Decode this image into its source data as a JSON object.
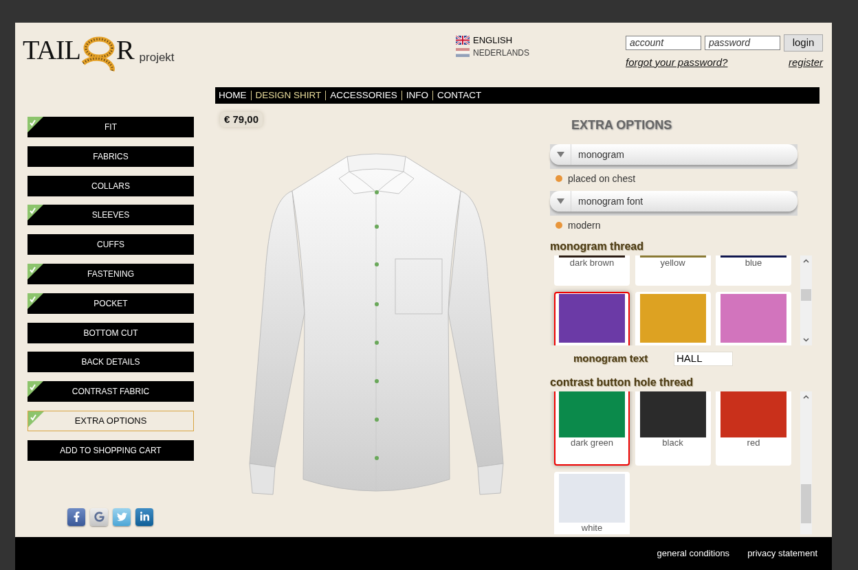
{
  "logo": {
    "text_left": "TAIL",
    "text_right": "R",
    "subtitle": "projekt"
  },
  "languages": [
    {
      "kind": "uk",
      "label": "ENGLISH",
      "selected": true
    },
    {
      "kind": "nl",
      "label": "NEDERLANDS",
      "selected": false
    }
  ],
  "login": {
    "account": {
      "placeholder": "account"
    },
    "password": {
      "placeholder": "password"
    },
    "button": "login",
    "forgot_link": "forgot your password?",
    "register_link": "register"
  },
  "nav": [
    {
      "label": "HOME",
      "selected": false
    },
    {
      "label": "DESIGN SHIRT",
      "selected": true
    },
    {
      "label": "ACCESSORIES",
      "selected": false
    },
    {
      "label": "INFO",
      "selected": false
    },
    {
      "label": "CONTACT",
      "selected": false
    }
  ],
  "sidebar": {
    "items": [
      {
        "label": "FIT",
        "checked": true,
        "selected": false
      },
      {
        "label": "FABRICS",
        "checked": false,
        "selected": false
      },
      {
        "label": "COLLARS",
        "checked": false,
        "selected": false
      },
      {
        "label": "SLEEVES",
        "checked": true,
        "selected": false
      },
      {
        "label": "CUFFS",
        "checked": false,
        "selected": false
      },
      {
        "label": "FASTENING",
        "checked": true,
        "selected": false
      },
      {
        "label": "POCKET",
        "checked": true,
        "selected": false
      },
      {
        "label": "BOTTOM CUT",
        "checked": false,
        "selected": false
      },
      {
        "label": "BACK DETAILS",
        "checked": false,
        "selected": false
      },
      {
        "label": "CONTRAST FABRIC",
        "checked": true,
        "selected": false
      },
      {
        "label": "EXTRA OPTIONS",
        "checked": true,
        "selected": true
      },
      {
        "label": "ADD TO SHOPPING CART",
        "checked": false,
        "selected": false
      }
    ]
  },
  "price": "€ 79,00",
  "options": {
    "title": "EXTRA OPTIONS",
    "selects": [
      {
        "label": "monogram",
        "value": "placed on chest"
      },
      {
        "label": "monogram font",
        "value": "modern"
      }
    ]
  },
  "monogram_thread": {
    "title": "monogram thread",
    "swatches": [
      {
        "label": "dark brown",
        "color": "#2b1c14",
        "selected": false
      },
      {
        "label": "yellow",
        "color": "#8a7a34",
        "selected": false
      },
      {
        "label": "blue",
        "color": "#10174f",
        "selected": false
      },
      {
        "color": "#6b3aa6",
        "selected": true
      },
      {
        "color": "#dda222",
        "selected": false
      },
      {
        "color": "#d274bd",
        "selected": false
      }
    ]
  },
  "monogram_text": {
    "label": "monogram text",
    "value": "HALL"
  },
  "button_hole_thread": {
    "title": "contrast button hole thread",
    "swatches": [
      {
        "label": "dark green",
        "color": "#0b8a4b",
        "selected": true
      },
      {
        "label": "black",
        "color": "#2b2b2b",
        "selected": false
      },
      {
        "label": "red",
        "color": "#c9301b",
        "selected": false
      },
      {
        "label": "white",
        "color": "#e3e7ee",
        "selected": false
      }
    ]
  },
  "social": [
    {
      "kind": "facebook"
    },
    {
      "kind": "google"
    },
    {
      "kind": "twitter"
    },
    {
      "kind": "linkedin"
    }
  ],
  "footer": {
    "links": [
      "general conditions",
      "privacy statement"
    ]
  }
}
